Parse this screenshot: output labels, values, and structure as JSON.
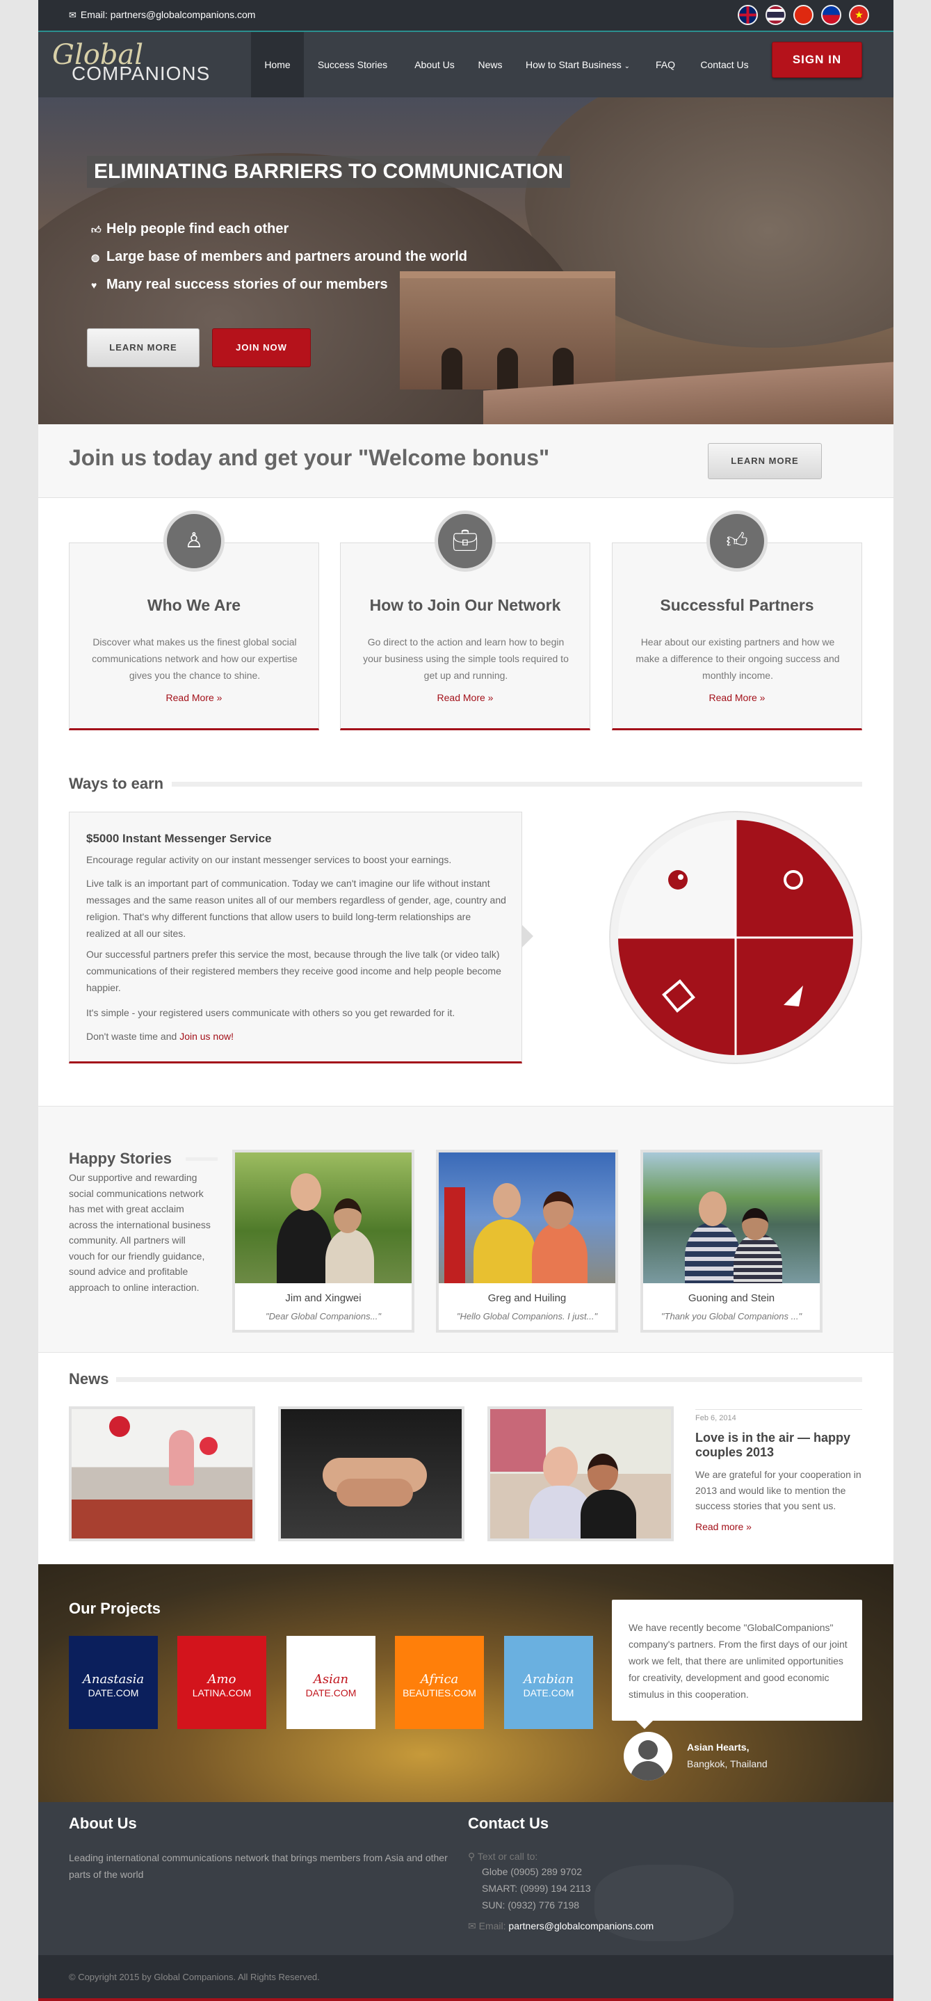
{
  "topbar": {
    "email": "Email: partners@globalcompanions.com"
  },
  "logo": {
    "line1": "Global",
    "line2": "COMPANIONS"
  },
  "nav": {
    "items": [
      "Home",
      "Success Stories",
      "About Us",
      "News",
      "How to Start Business",
      "FAQ",
      "Contact Us"
    ],
    "signin": "SIGN IN"
  },
  "hero": {
    "title": "ELIMINATING BARRIERS TO COMMUNICATION",
    "bullets": [
      "Help people find each other",
      "Large base of members and partners around the world",
      "Many real success stories of our members"
    ],
    "learn_more": "LEARN MORE",
    "join_now": "JOIN NOW"
  },
  "welcome": {
    "title": "Join us today and get your \"Welcome bonus\"",
    "button": "LEARN MORE"
  },
  "features": [
    {
      "title": "Who We Are",
      "text": "Discover what makes us the finest global social communications network and how our expertise gives you the chance to shine.",
      "link": "Read More »"
    },
    {
      "title": "How to Join Our Network",
      "text": "Go direct to the action and learn how to begin your business using the simple tools required to get up and running.",
      "link": "Read More »"
    },
    {
      "title": "Successful Partners",
      "text": "Hear about our existing partners and how we make a difference to their ongoing success and monthly income.",
      "link": "Read More »"
    }
  ],
  "ways": {
    "title": "Ways to earn",
    "box_title": "$5000 Instant Messenger Service",
    "p1": "Encourage regular activity on our instant messenger services to boost your earnings.",
    "p2": "Live talk is an important part of communication. Today we can't imagine our life without instant messages and the same reason unites all of our members regardless of gender, age, country and religion. That's why different functions that allow users to build long-term relationships are realized at all our sites.",
    "p3": "Our successful partners prefer this service the most, because through the live talk (or video talk) communications of their registered members they receive good income and help people become happier.",
    "p4": "It's simple - your registered users communicate with others so you get rewarded for it.",
    "p5_prefix": "Don't waste time and ",
    "p5_link": "Join us now!"
  },
  "stories": {
    "title": "Happy Stories",
    "text": "Our supportive and rewarding social communications network has met with great acclaim across the international business community. All partners will vouch for our friendly guidance, sound advice and profitable approach to online interaction.",
    "items": [
      {
        "name": "Jim and Xingwei",
        "quote": "\"Dear Global Companions...\""
      },
      {
        "name": "Greg and Huiling",
        "quote": "\"Hello Global Companions. I just...\""
      },
      {
        "name": "Guoning and Stein",
        "quote": "\"Thank you Global Companions ...\""
      }
    ]
  },
  "news": {
    "title": "News",
    "date": "Feb 6, 2014",
    "headline": "Love is in the air — happy couples 2013",
    "text": "We are grateful for your cooperation in 2013 and would like to mention the success stories that you sent us.",
    "link": "Read more »"
  },
  "projects": {
    "title": "Our Projects",
    "items": [
      {
        "name": "Anastasia",
        "domain": "DATE.COM",
        "bg": "#0b1f5c",
        "fg": "#ffffff"
      },
      {
        "name": "Amo",
        "domain": "LATINA.COM",
        "bg": "#d3141c",
        "fg": "#ffffff"
      },
      {
        "name": "Asian",
        "domain": "DATE.COM",
        "bg": "#ffffff",
        "fg": "#c0141c"
      },
      {
        "name": "Africa",
        "domain": "BEAUTIES.COM",
        "bg": "#ff7f0a",
        "fg": "#ffffff"
      },
      {
        "name": "Arabian",
        "domain": "DATE.COM",
        "bg": "#6ab0e0",
        "fg": "#ffffff"
      }
    ],
    "testimonial": "We have recently become \"GlobalCompanions\" company's partners. From the first days of our joint work we felt, that there are unlimited opportunities for creativity, development and good economic stimulus in this cooperation.",
    "author_name": "Asian Hearts,",
    "author_location": "Bangkok, Thailand"
  },
  "footer": {
    "about_title": "About Us",
    "about_text": "Leading international communications network that brings members from Asia and other parts of the world",
    "contact_title": "Contact Us",
    "call_label": "Text or call to:",
    "globe": "Globe (0905) 289 9702",
    "smart": "SMART: (0999) 194 2113",
    "sun": "SUN: (0932) 776 7198",
    "email_label": "Email:",
    "email": "partners@globalcompanions.com",
    "copyright": "© Copyright 2015 by Global Companions. All Rights Reserved."
  },
  "colors": {
    "accent": "#a3111a",
    "dark": "#2b2f35",
    "nav": "#3a3f46"
  }
}
